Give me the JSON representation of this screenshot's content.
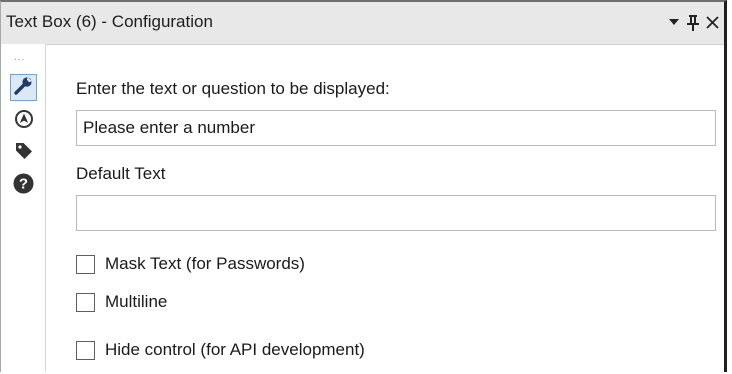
{
  "window": {
    "title": "Text Box (6) - Configuration",
    "controls": [
      {
        "name": "dropdown-arrow-icon",
        "glyph": "▾"
      },
      {
        "name": "pin-icon",
        "glyph": "pin"
      },
      {
        "name": "close-icon",
        "glyph": "✕"
      }
    ]
  },
  "sidebar": {
    "grip": "...",
    "items": [
      {
        "name": "configuration-tab",
        "icon": "wrench-icon",
        "active": true
      },
      {
        "name": "annotation-tab",
        "icon": "navigation-circle-icon",
        "active": false
      },
      {
        "name": "tag-tab",
        "icon": "tag-icon",
        "active": false
      },
      {
        "name": "help-tab",
        "icon": "help-icon",
        "active": false
      }
    ]
  },
  "form": {
    "prompt_label": "Enter the text or question to be displayed:",
    "prompt_value": "Please enter a number",
    "default_label": "Default Text",
    "default_value": "",
    "checkboxes": [
      {
        "label": "Mask Text (for Passwords)",
        "checked": false
      },
      {
        "label": "Multiline",
        "checked": false
      },
      {
        "label": "Hide control (for API development)",
        "checked": false
      }
    ]
  },
  "colors": {
    "titlebar": "#e8e8e8",
    "active_tab_fill": "#dbe9f7",
    "active_tab_border": "#6fa3d6",
    "icon": "#333333"
  }
}
